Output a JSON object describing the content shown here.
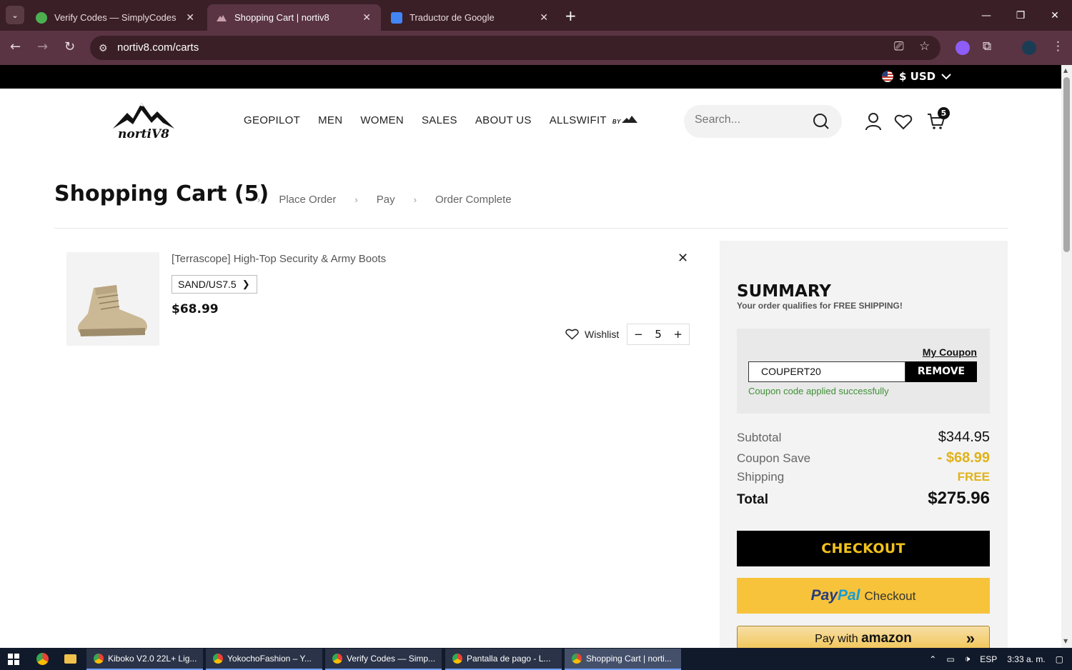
{
  "browser": {
    "tabs": [
      {
        "title": "Verify Codes — SimplyCodes",
        "active": false
      },
      {
        "title": "Shopping Cart | nortiv8",
        "active": true
      },
      {
        "title": "Traductor de Google",
        "active": false
      }
    ],
    "url": "nortiv8.com/carts"
  },
  "site": {
    "currency": "$ USD",
    "logo_text": "nortiV8",
    "nav": [
      "GEOPILOT",
      "MEN",
      "WOMEN",
      "SALES",
      "ABOUT US",
      "ALLSWIFIT"
    ],
    "nav_by": "BY",
    "search_placeholder": "Search...",
    "cart_count": "5"
  },
  "cart": {
    "title": "Shopping Cart (5)",
    "steps": [
      "Place Order",
      "Pay",
      "Order Complete"
    ],
    "item": {
      "name": "[Terrascope] High-Top Security & Army Boots",
      "variant": "SAND/US7.5",
      "price": "$68.99",
      "wishlist_label": "Wishlist",
      "quantity": "5",
      "minus": "−",
      "plus": "+"
    }
  },
  "summary": {
    "title": "SUMMARY",
    "subtitle": "Your order qualifies for FREE SHIPPING!",
    "my_coupon": "My Coupon",
    "coupon_code": "COUPERT20",
    "remove_label": "REMOVE",
    "coupon_message": "Coupon code applied successfully",
    "rows": [
      {
        "label": "Subtotal",
        "value": "$344.95"
      },
      {
        "label": "Coupon Save",
        "value": "- $68.99"
      },
      {
        "label": "Shipping",
        "value": "FREE"
      },
      {
        "label": "Total",
        "value": "$275.96"
      }
    ],
    "checkout_label": "CHECKOUT",
    "paypal": {
      "pay": "Pay",
      "pal": "Pal",
      "checkout": "Checkout"
    },
    "amazon": {
      "prefix": "Pay with",
      "brand": "amazon"
    }
  },
  "taskbar": {
    "apps": [
      "Kiboko V2.0 22L+ Lig...",
      "YokochoFashion – Y...",
      "Verify Codes — Simp...",
      "Pantalla de pago - L...",
      "Shopping Cart | norti..."
    ],
    "lang": "ESP",
    "time": "3:33 a. m."
  },
  "colors": {
    "accent_gold": "#f2c21b",
    "success_green": "#3f8f35",
    "browser_bg": "#3a1f27"
  }
}
